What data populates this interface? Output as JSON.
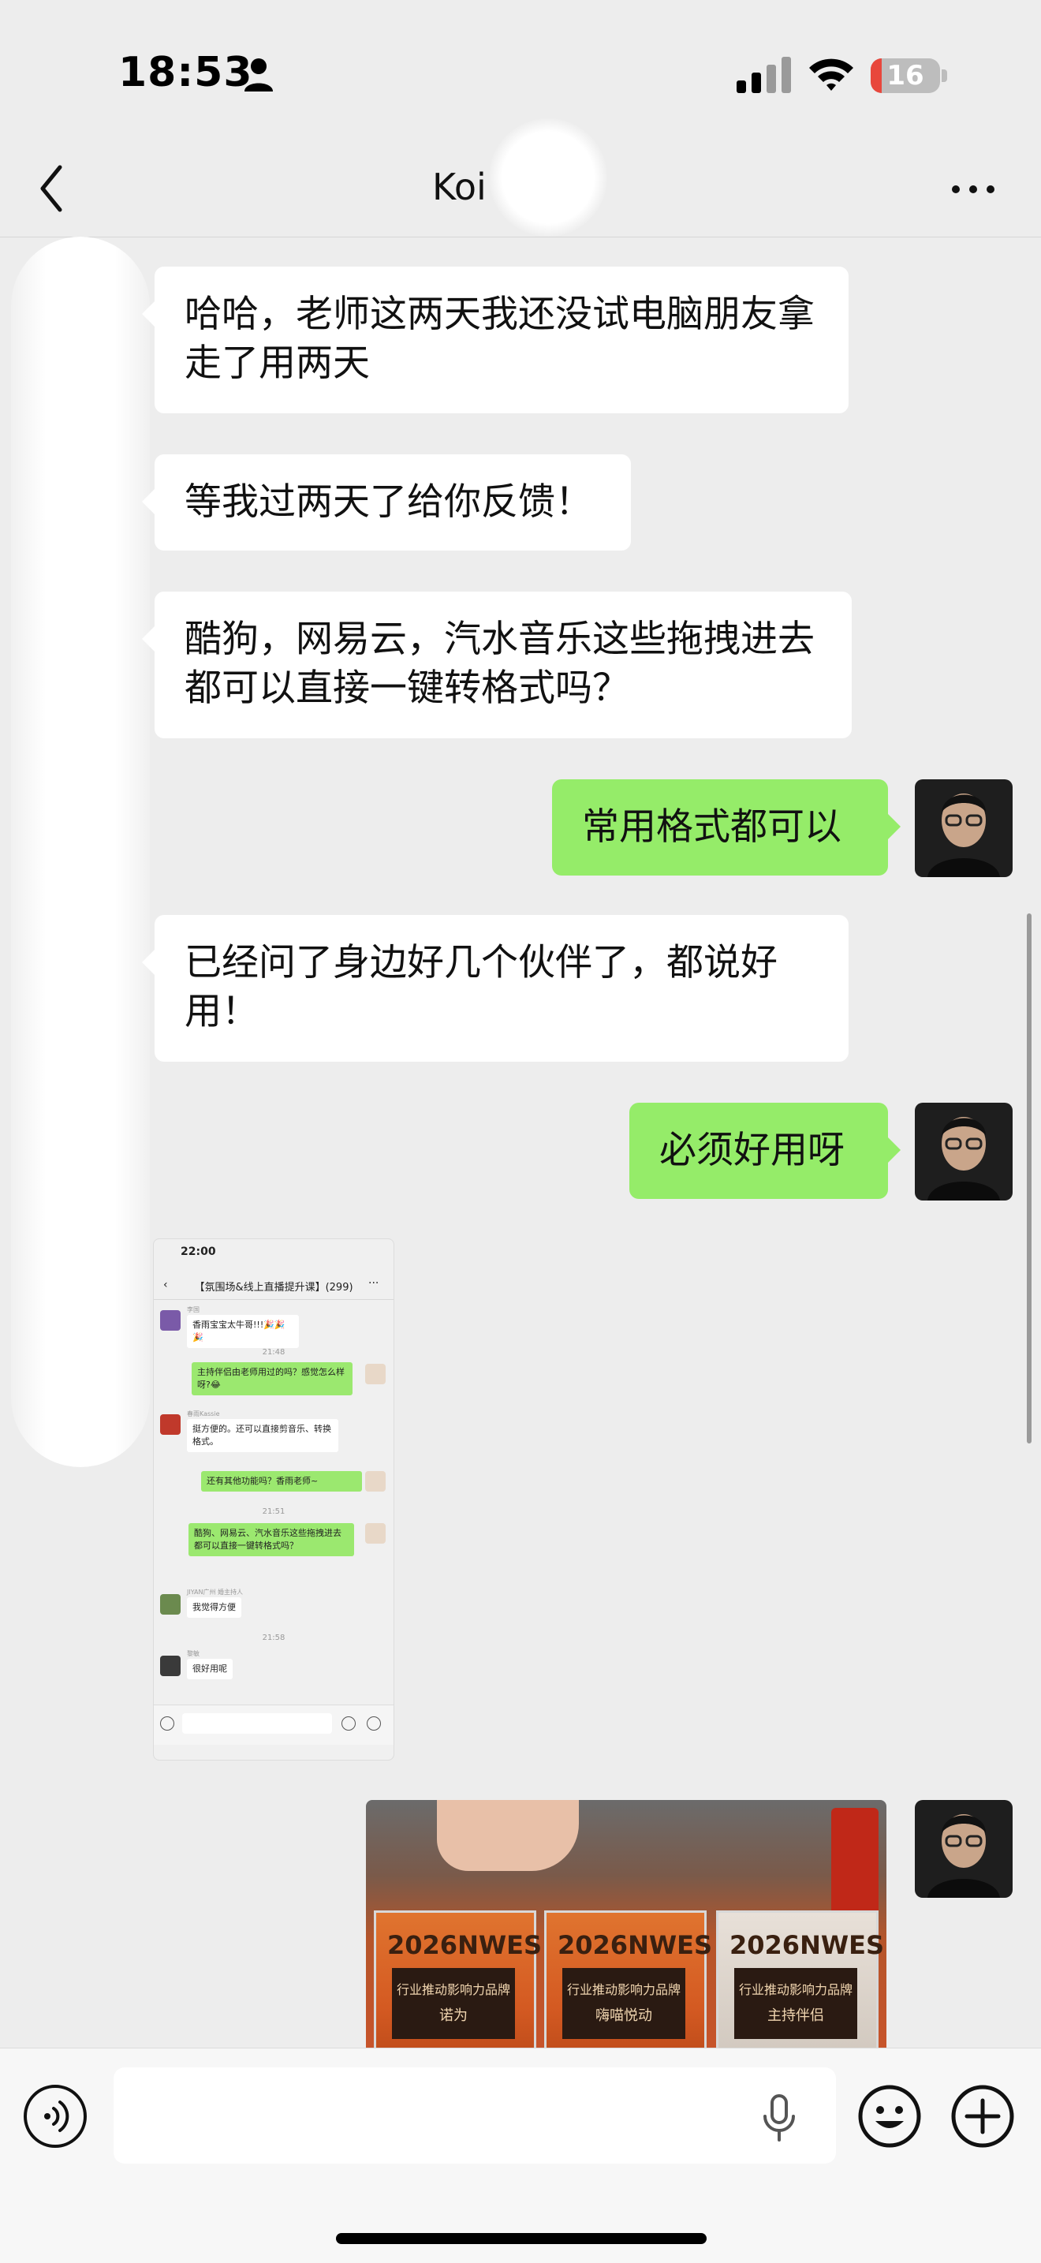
{
  "status_bar": {
    "time": "18:53",
    "battery": "16",
    "battery_level": 0.16
  },
  "nav": {
    "title": "Koi"
  },
  "messages": [
    {
      "side": "in",
      "text": "哈哈，老师这两天我还没试电脑朋友拿走了用两天"
    },
    {
      "side": "in",
      "text": "等我过两天了给你反馈！"
    },
    {
      "side": "in",
      "text": "酷狗，网易云，汽水音乐这些拖拽进去都可以直接一键转格式吗？"
    },
    {
      "side": "out",
      "text": "常用格式都可以"
    },
    {
      "side": "in",
      "text": "已经问了身边好几个伙伴了，都说好用！"
    },
    {
      "side": "out",
      "text": "必须好用呀"
    }
  ],
  "screenshot": {
    "time": "22:00",
    "title": "【氛围场&线上直播提升课】(299)",
    "msgs": [
      {
        "name": "李国",
        "text": "香雨宝宝太牛哥!!!🎉🎉🎉"
      },
      {
        "time": "21:48"
      },
      {
        "text": "主持伴侣由老师用过的吗？感觉怎么样呀?😂"
      },
      {
        "name": "春雨Kassie",
        "text": "挺方便的。还可以直接剪音乐、转换格式。"
      },
      {
        "text": "还有其他功能吗？香雨老师~"
      },
      {
        "time": "21:51"
      },
      {
        "text": "酷狗、网易云、汽水音乐这些拖拽进去都可以直接一键转格式吗？"
      },
      {
        "name": "JIYAN广州 婚主持人",
        "text": "我觉得方便"
      },
      {
        "time": "21:58"
      },
      {
        "name": "黎敏",
        "text": "很好用呢"
      }
    ]
  },
  "photo": {
    "plaques": [
      {
        "logo": "2026NWES",
        "line1": "行业推动影响力品牌",
        "line2": "诺为"
      },
      {
        "logo": "2026NWES",
        "line1": "行业推动影响力品牌",
        "line2": "嗨喵悦动"
      },
      {
        "logo": "2026NWES",
        "line1": "行业推动影响力品牌",
        "line2": "主持伴侣"
      }
    ]
  },
  "icons": {
    "back": "chevron-left-icon",
    "more": "more-dots-icon",
    "voice": "voice-mode-icon",
    "mic": "microphone-icon",
    "emoji": "emoji-icon",
    "plus": "plus-icon"
  },
  "colors": {
    "bubble_out": "#95ec69",
    "bubble_in": "#ffffff",
    "background": "#ededed"
  }
}
